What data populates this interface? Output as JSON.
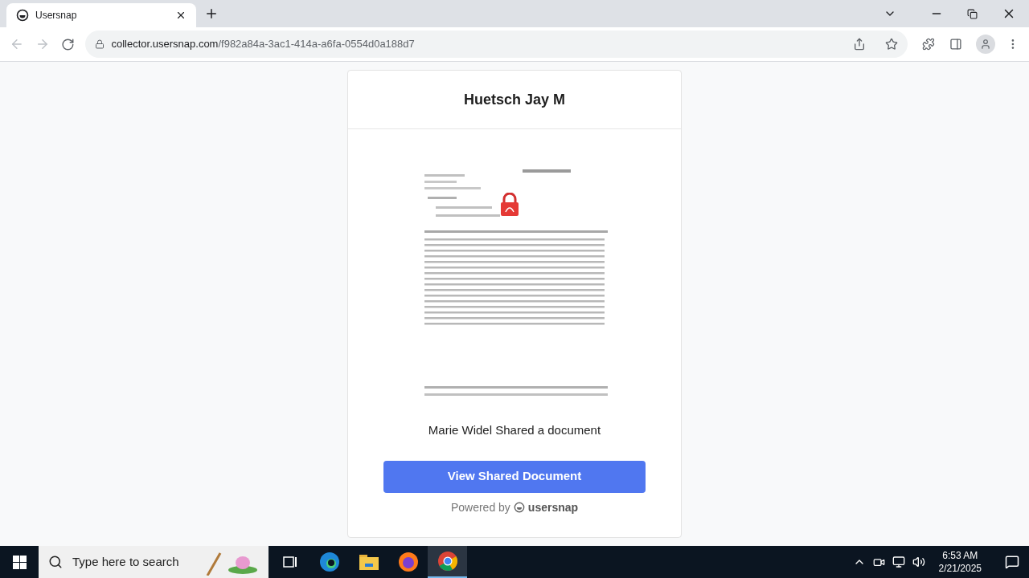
{
  "browser": {
    "tabs": [
      {
        "title": "Usersnap",
        "selected": true
      }
    ],
    "url_domain": "collector.usersnap.com",
    "url_path": "/f982a84a-3ac1-414a-a6fa-0554d0a188d7"
  },
  "card": {
    "title": "Huetsch Jay M",
    "message": "Marie Widel Shared a document",
    "button": "View Shared Document",
    "powered_by": "Powered by",
    "brand": "usersnap"
  },
  "taskbar": {
    "search_placeholder": "Type here to search",
    "apps": [
      {
        "kind": "taskview",
        "selected": false
      },
      {
        "kind": "edge",
        "selected": false
      },
      {
        "kind": "explorer",
        "selected": false
      },
      {
        "kind": "firefox",
        "selected": false
      },
      {
        "kind": "chrome",
        "selected": true
      }
    ],
    "time": "6:53 AM",
    "date": "2/21/2025"
  }
}
